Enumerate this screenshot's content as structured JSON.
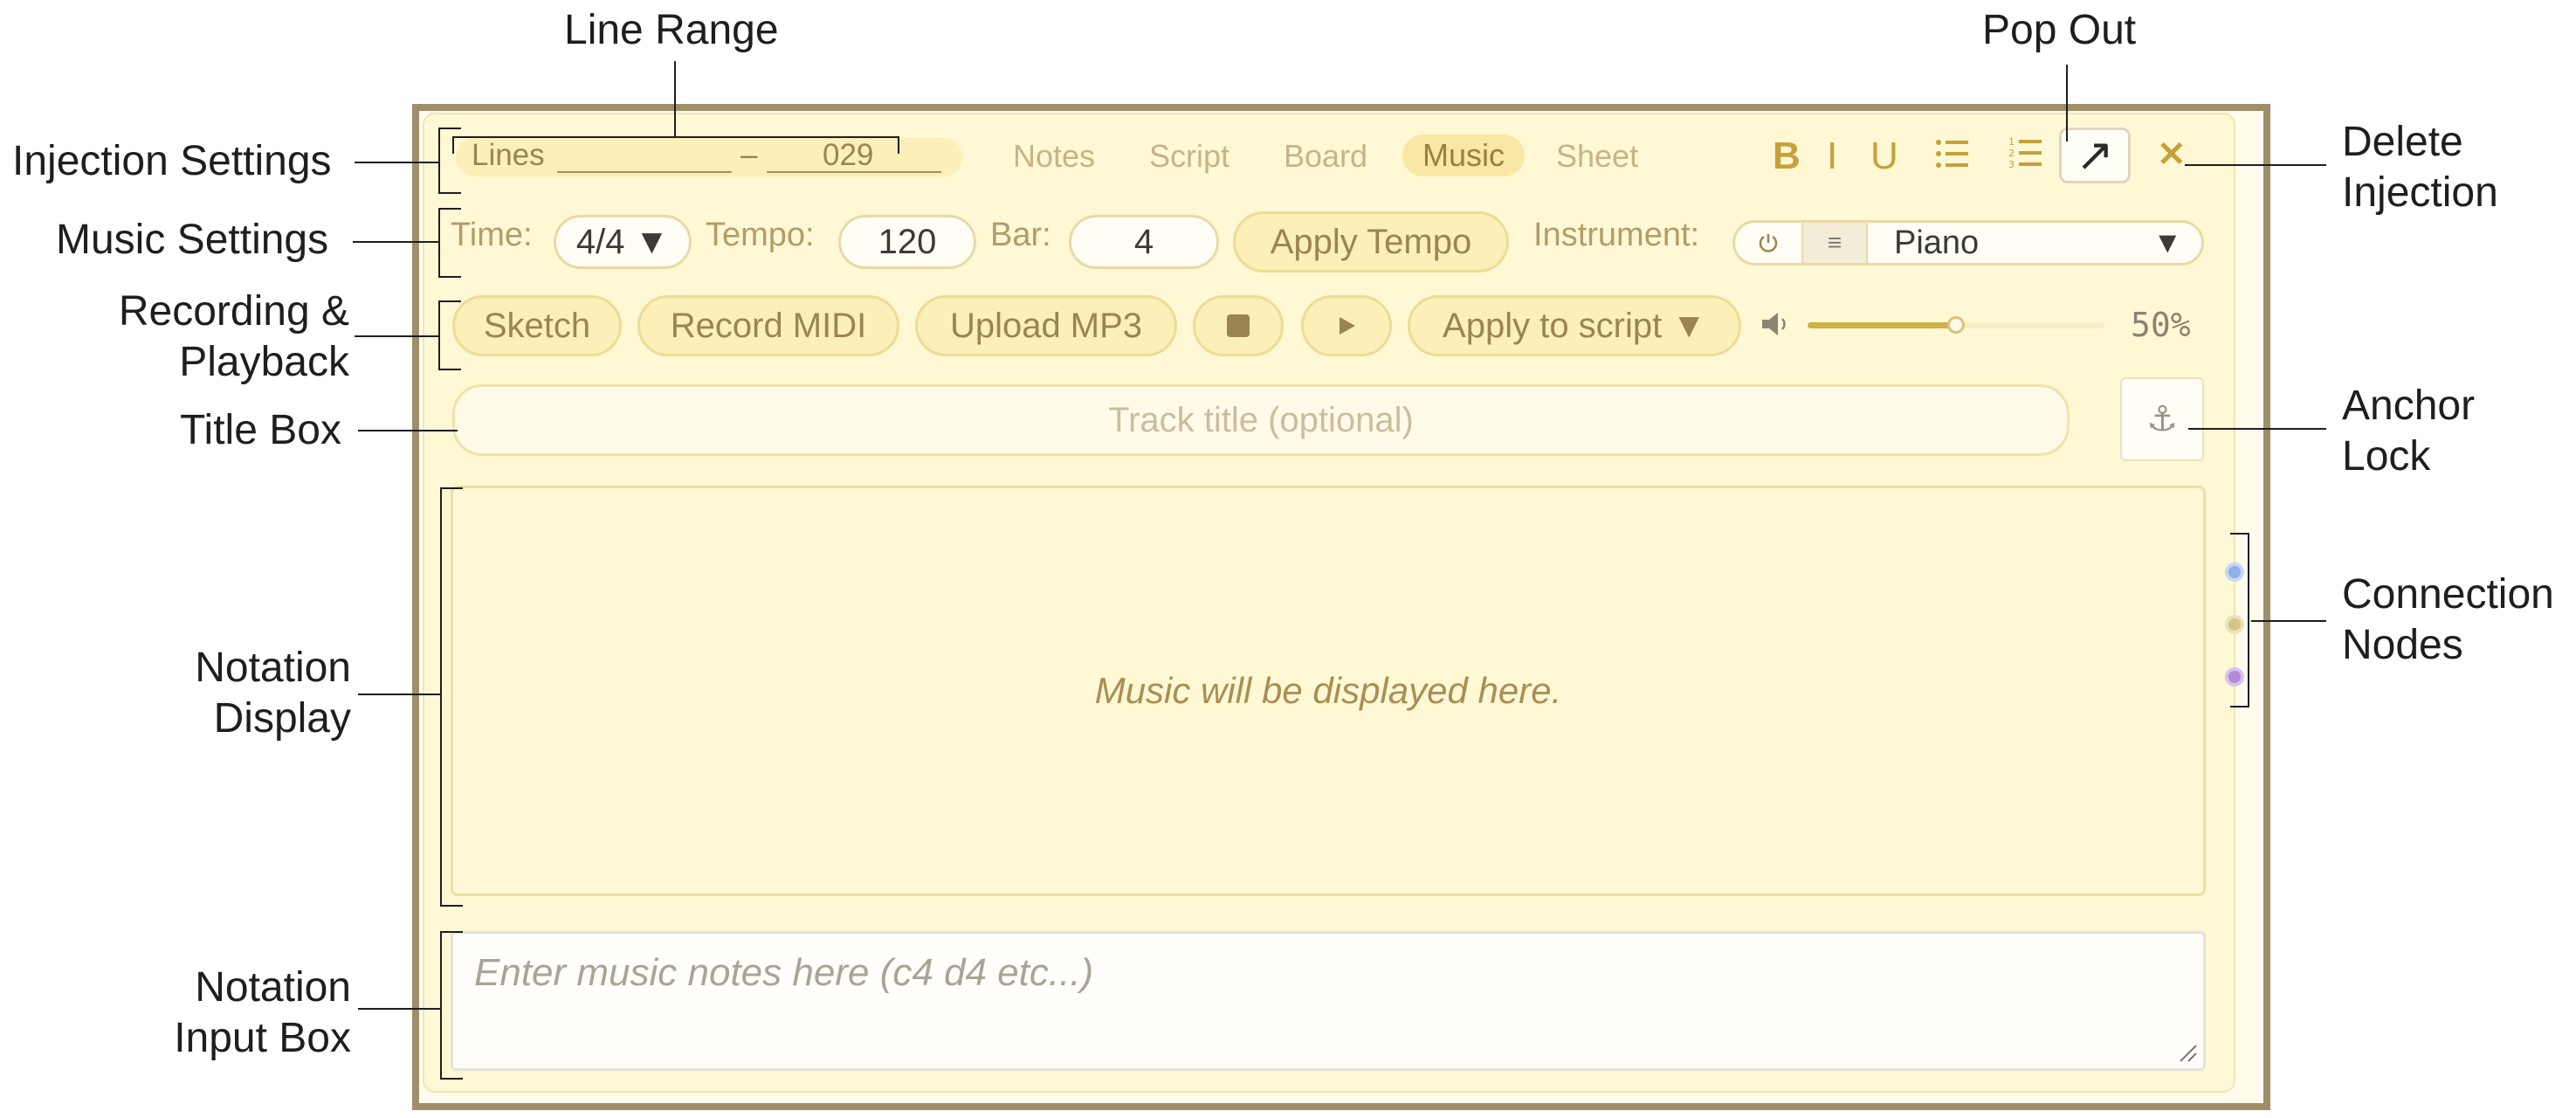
{
  "annotations": {
    "line_range": "Line Range",
    "pop_out": "Pop Out",
    "injection_settings": "Injection Settings",
    "music_settings": "Music Settings",
    "recording_line1": "Recording &",
    "recording_line2": "Playback",
    "title_box": "Title Box",
    "notation_display_line1": "Notation",
    "notation_display_line2": "Display",
    "notation_input_line1": "Notation",
    "notation_input_line2": "Input Box",
    "delete_line1": "Delete",
    "delete_line2": "Injection",
    "anchor_line1": "Anchor",
    "anchor_line2": "Lock",
    "connection_line1": "Connection",
    "connection_line2": "Nodes"
  },
  "header": {
    "lines_label": "Lines",
    "range_dash": "–",
    "range_end": "029",
    "tabs": [
      "Notes",
      "Script",
      "Board",
      "Music",
      "Sheet"
    ],
    "active_tab": "Music",
    "format_bold": "B",
    "format_italic": "I",
    "format_underline": "U",
    "popout_icon": "↗",
    "close_icon": "✕"
  },
  "music_settings": {
    "time_label": "Time:",
    "time_value": "4/4 ▼",
    "tempo_label": "Tempo:",
    "tempo_value": "120",
    "bar_label": "Bar:",
    "bar_value": "4",
    "apply_tempo": "Apply Tempo",
    "instrument_label": "Instrument:",
    "instrument_value": "Piano",
    "instrument_arrow": "▼"
  },
  "playback": {
    "sketch": "Sketch",
    "record_midi": "Record MIDI",
    "upload_mp3": "Upload MP3",
    "apply_to_script": "Apply to script ▼",
    "volume_percent": "50%",
    "volume_level": 0.5
  },
  "title_box": {
    "placeholder": "Track title (optional)",
    "anchor_icon": "⚓"
  },
  "notation": {
    "display_text": "Music will be displayed here.",
    "input_placeholder": "Enter music notes here (c4 d4 etc...)"
  },
  "connection_nodes": [
    {
      "color": "#8fb2e6",
      "ring": "#c6d8f4"
    },
    {
      "color": "#d4c48c",
      "ring": "#ece2b8"
    },
    {
      "color": "#b28ad8",
      "ring": "#d8c2ee"
    }
  ]
}
